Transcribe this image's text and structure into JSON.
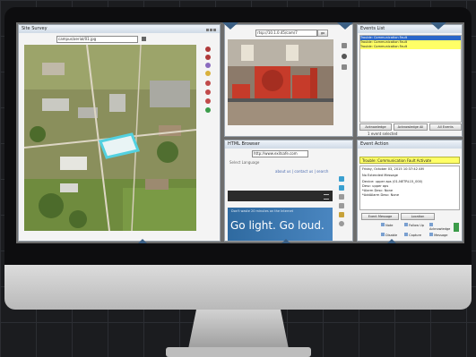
{
  "map_window": {
    "title": "Site Survey",
    "address_value": "campus/aerial/01.jpg"
  },
  "camera_window": {
    "address_value": "rtsp://10.1.0.45/cam/7"
  },
  "events_window": {
    "title": "Events List",
    "rows": [
      "Trouble: Communication Fault",
      "Trouble: Communication Fault",
      "Trouble: Communication Fault"
    ],
    "button_ack": "Acknowledge",
    "button_ack_all": "Acknowledge All",
    "button_all": "All Events"
  },
  "browser_window": {
    "title": "HTML Browser",
    "url": "http://www.exitsafe.com",
    "line1": "Select Language",
    "line2": "about us | contact us | search",
    "banner_top": "Don't waste 20 minutes on the Internet",
    "banner_main": "Go light. Go loud."
  },
  "event_detail_window": {
    "title": "Event Action",
    "header": "Trouble: Communication Fault Activate",
    "timestamp": "Friday, October 03, 2015 10:37:42 AM",
    "no_message": "No Extended Message",
    "device": "Device: upper aps (01-NETRL15_000)",
    "desc": "Desc: upper aps",
    "alarm_desc": "*Alarm Desc: None",
    "add_alarm_desc": "*AddAlarm Desc: None",
    "tab_event": "Event Message",
    "tab_location": "Location",
    "opt_note": "Note",
    "opt_follow_up": "Follow Up",
    "opt_disable": "Disable",
    "opt_capture": "Capture",
    "opt_ack": "Acknowledge",
    "opt_message": "Message"
  },
  "status_text": "1 event selected",
  "colors": {
    "highlight_yellow": "#ffff66",
    "selection_blue": "#2a66c8",
    "pump_red": "#c63b2a",
    "accent_cyan": "#53d1e0"
  }
}
